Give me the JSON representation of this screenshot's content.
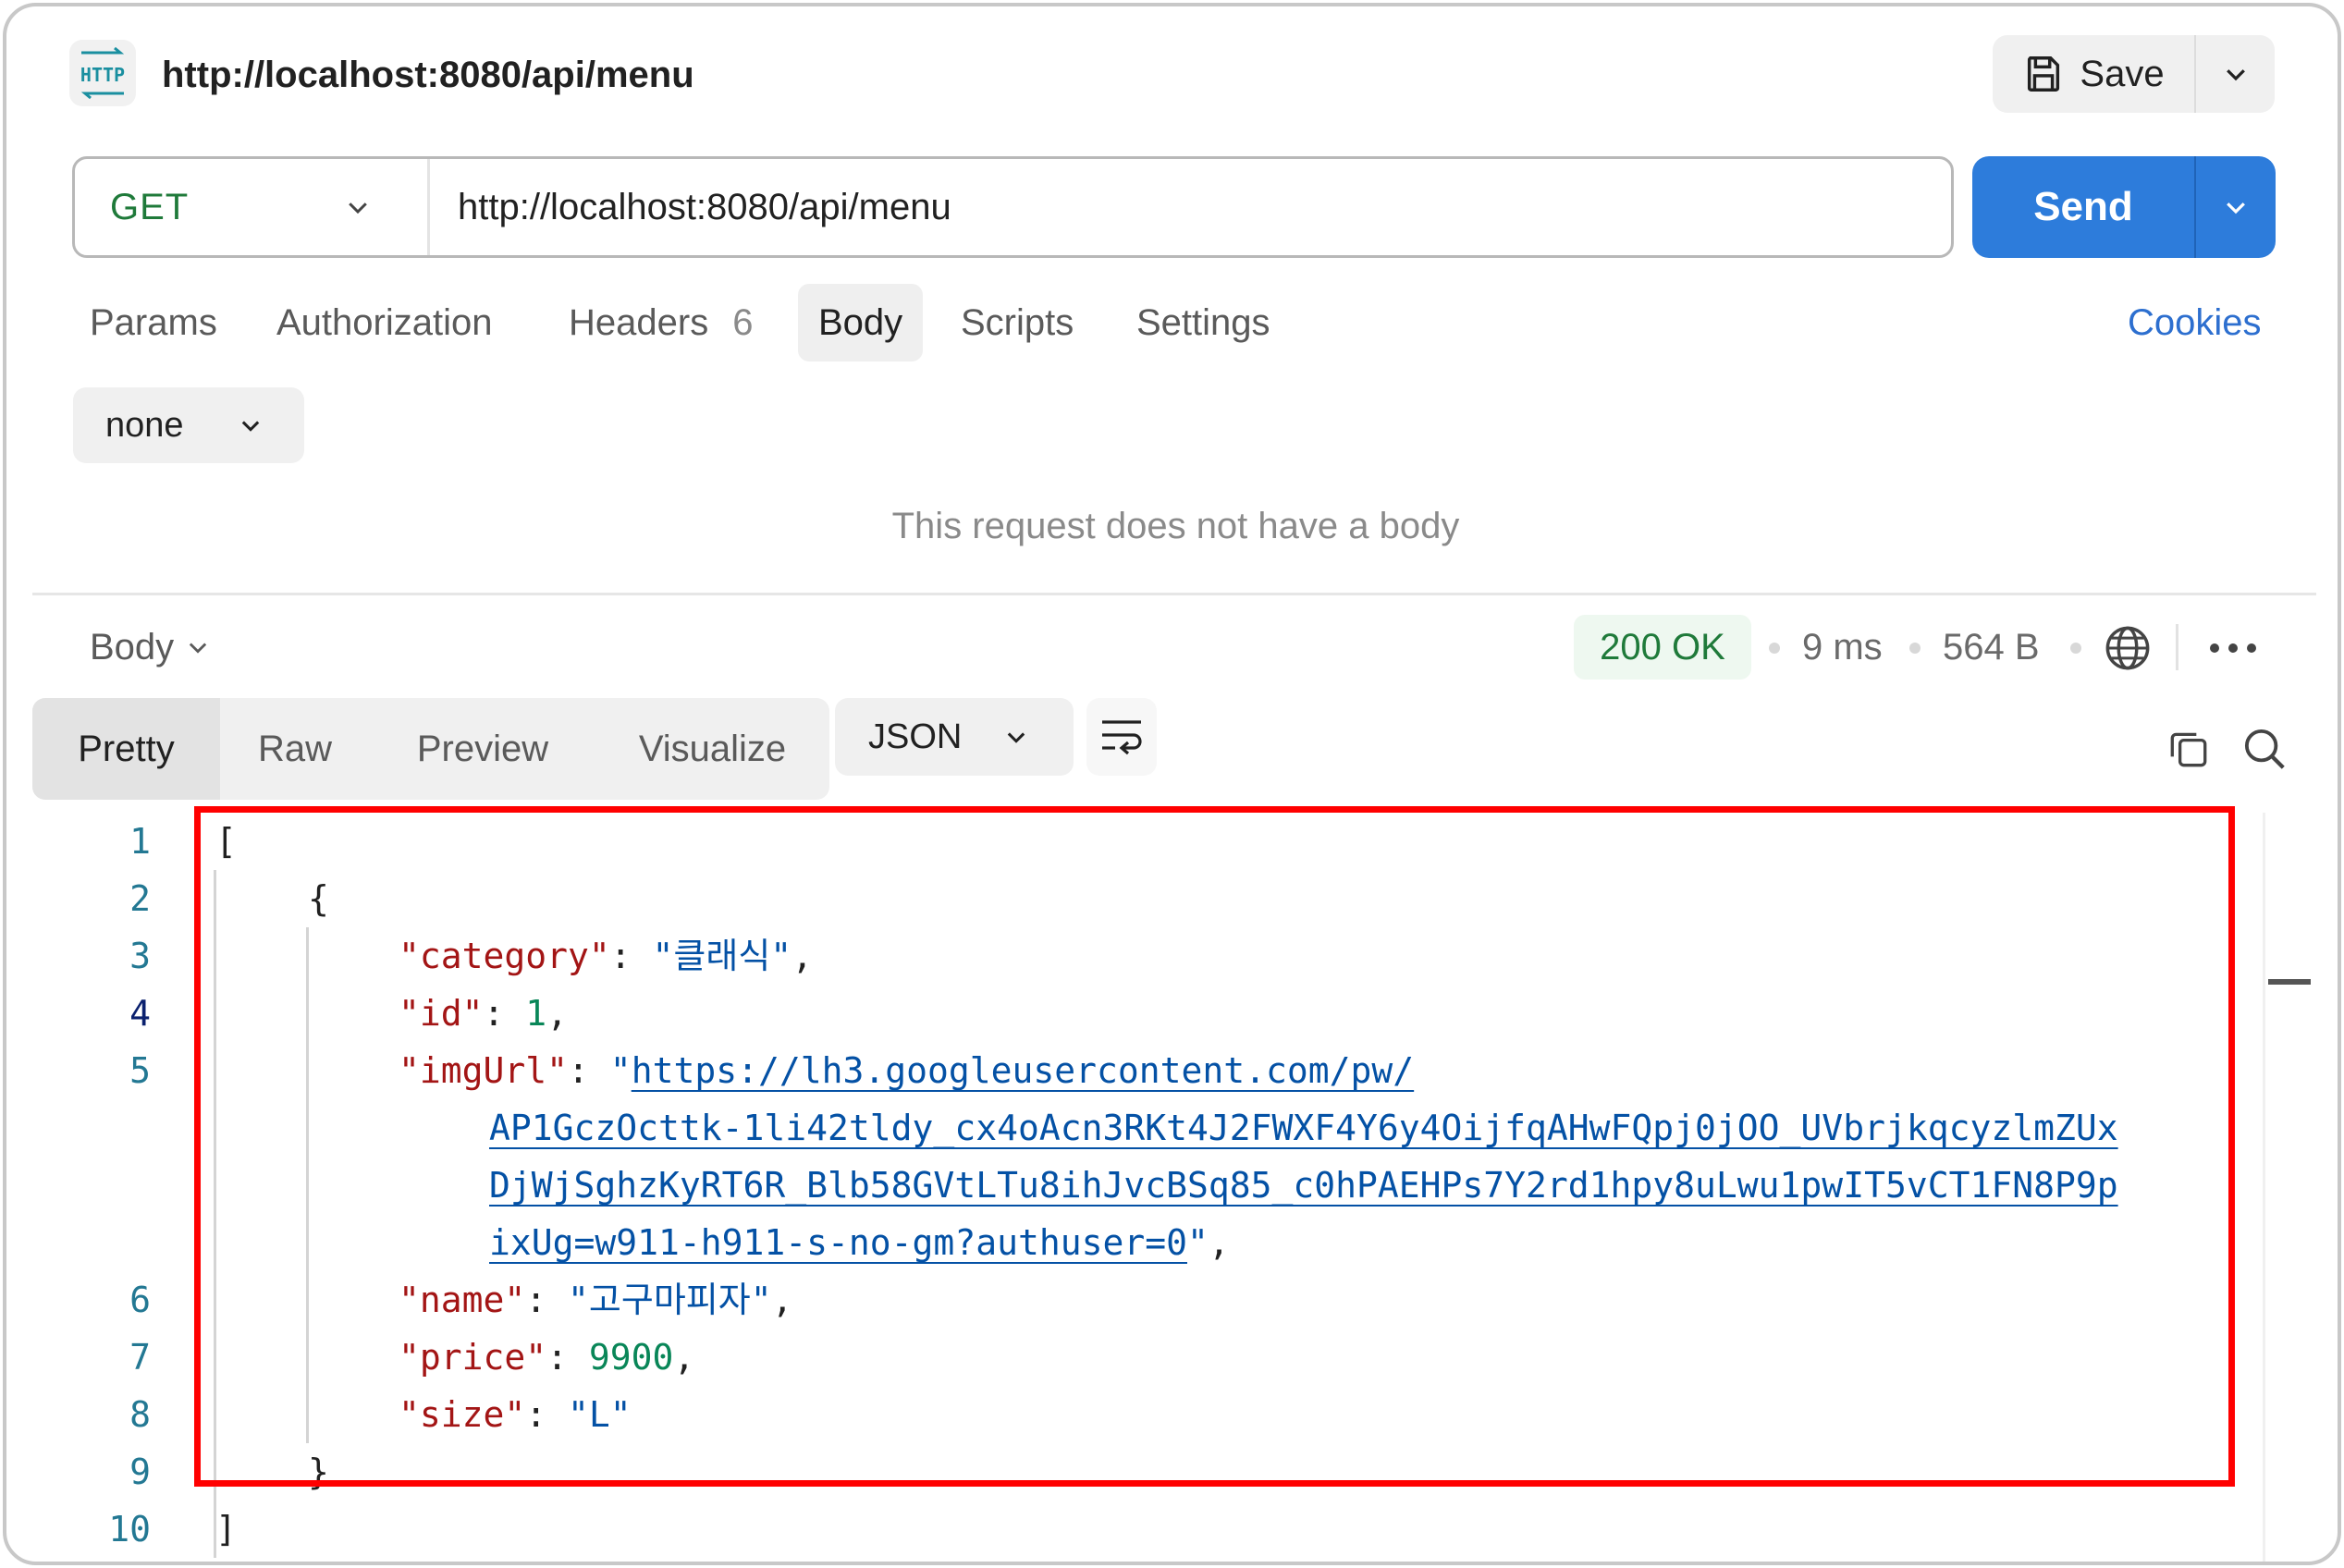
{
  "request": {
    "badge_text": "HTTP",
    "title": "http://localhost:8080/api/menu",
    "save_label": "Save",
    "method": "GET",
    "url": "http://localhost:8080/api/menu",
    "send_label": "Send"
  },
  "request_tabs": {
    "params": "Params",
    "authorization": "Authorization",
    "headers": "Headers",
    "headers_count": "6",
    "body": "Body",
    "scripts": "Scripts",
    "settings": "Settings",
    "active": "Body"
  },
  "cookies_label": "Cookies",
  "body_type": "none",
  "empty_body_message": "This request does not have a body",
  "response": {
    "section_label": "Body",
    "status": "200 OK",
    "time": "9 ms",
    "size": "564 B",
    "view_tabs": {
      "pretty": "Pretty",
      "raw": "Raw",
      "preview": "Preview",
      "visualize": "Visualize",
      "active": "Pretty"
    },
    "format": "JSON",
    "line_numbers": [
      "1",
      "2",
      "3",
      "4",
      "5",
      "6",
      "7",
      "8",
      "9",
      "10"
    ],
    "code": {
      "open_bracket": "[",
      "open_brace": "{",
      "category_key": "\"category\"",
      "category_value": "\"클래식\"",
      "id_key": "\"id\"",
      "id_value": "1",
      "imgurl_key": "\"imgUrl\"",
      "imgurl_parts": [
        "https://lh3.googleusercontent.com/pw/",
        "AP1GczOcttk-1li42tldy_cx4oAcn3RKt4J2FWXF4Y6y4OijfqAHwFQpj0jOO_UVbrjkqcyzlmZUx",
        "DjWjSghzKyRT6R_Blb58GVtLTu8ihJvcBSq85_c0hPAEHPs7Y2rd1hpy8uLwu1pwIT5vCT1FN8P9p",
        "ixUg=w911-h911-s-no-gm?authuser=0"
      ],
      "name_key": "\"name\"",
      "name_value": "\"고구마피자\"",
      "price_key": "\"price\"",
      "price_value": "9900",
      "size_key": "\"size\"",
      "size_value": "\"L\"",
      "close_brace": "}",
      "close_bracket": "]"
    }
  },
  "colors": {
    "accent": "#2d7cdb",
    "status_ok": "#1f7a3a",
    "highlight": "#ff0000"
  },
  "icons": {
    "save": "floppy-disk-icon",
    "caret": "chevron-down-icon",
    "network": "globe-icon",
    "more": "ellipsis-icon",
    "wrap": "word-wrap-icon",
    "copy": "copy-icon",
    "search": "search-icon"
  }
}
